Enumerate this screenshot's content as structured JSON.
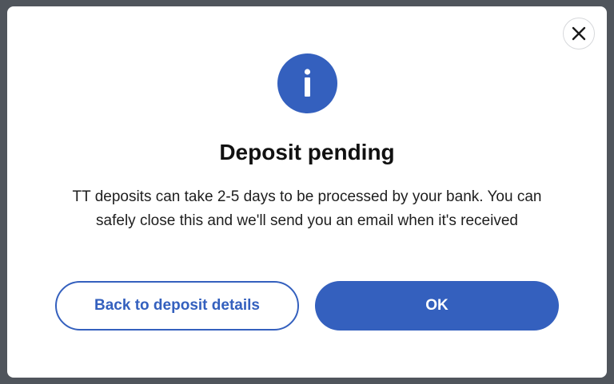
{
  "dialog": {
    "title": "Deposit pending",
    "message_line1": "TT deposits can take 2-5 days to be processed by your bank. You can",
    "message_line2": "safely close this and we'll send you an email when it's received",
    "icon": "info-icon",
    "close_icon": "close-icon"
  },
  "buttons": {
    "back_label": "Back to deposit details",
    "ok_label": "OK"
  },
  "colors": {
    "accent": "#3460be",
    "backdrop": "#50555c",
    "surface": "#ffffff",
    "title_text": "#111111"
  }
}
